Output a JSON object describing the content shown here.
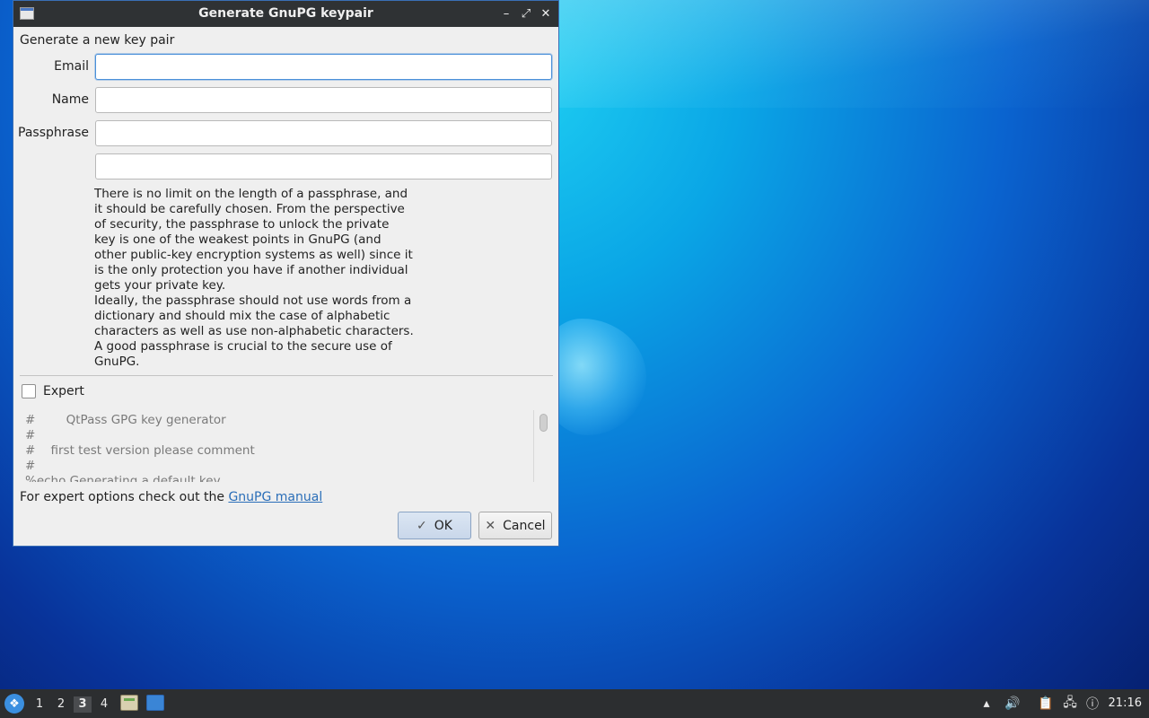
{
  "window": {
    "title": "Generate GnuPG keypair",
    "controls": {
      "minimize": "–",
      "maximize": "⤢",
      "close": "✕"
    }
  },
  "form": {
    "heading": "Generate a new key pair",
    "email_label": "Email",
    "email_value": "",
    "name_label": "Name",
    "name_value": "",
    "passphrase_label": "Passphrase",
    "passphrase_value": "",
    "passphrase_confirm_value": "",
    "help_text": "There is no limit on the length of a passphrase, and\nit should be carefully chosen. From the perspective\nof security, the passphrase to unlock the private\nkey is one of the weakest points in GnuPG (and\nother public-key encryption systems as well) since it\nis the only protection you have if another individual\ngets your private key.\nIdeally, the passphrase should not use words from a\ndictionary and should mix the case of alphabetic\ncharacters as well as use non-alphabetic characters.\nA good passphrase is crucial to the secure use of\nGnuPG.",
    "expert_label": "Expert",
    "expert_checked": false,
    "script_text": "#        QtPass GPG key generator\n#\n#    first test version please comment\n#\n%echo Generating a default key",
    "manual_prefix": "For expert options check out the ",
    "manual_link": "GnuPG manual",
    "ok_label": "OK",
    "cancel_label": "Cancel"
  },
  "taskbar": {
    "workspaces": [
      "1",
      "2",
      "3",
      "4"
    ],
    "active_workspace": "3",
    "clock": "21:16",
    "icons": [
      "start-menu-icon",
      "file-manager-icon",
      "window-icon",
      "tray-up-icon",
      "volume-icon",
      "clipboard-icon",
      "network-icon",
      "notification-icon"
    ]
  }
}
